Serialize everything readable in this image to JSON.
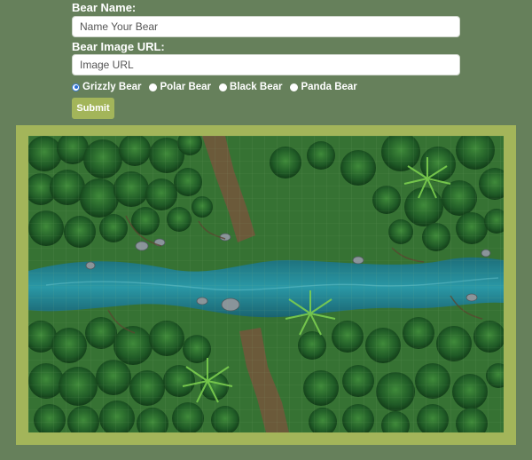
{
  "form": {
    "name_label": "Bear Name:",
    "name_placeholder": "Name Your Bear",
    "url_label": "Bear Image URL:",
    "url_placeholder": "Image URL",
    "radio_options": [
      {
        "label": "Grizzly Bear",
        "checked": true
      },
      {
        "label": "Polar Bear",
        "checked": false
      },
      {
        "label": "Black Bear",
        "checked": false
      },
      {
        "label": "Panda Bear",
        "checked": false
      }
    ],
    "submit_label": "Submit"
  },
  "colors": {
    "page_background": "#66805b",
    "accent": "#a3b55a",
    "radio_selected": "#2a6fd6"
  },
  "map_image": {
    "subject": "top-down forest map with a river and dirt paths"
  }
}
